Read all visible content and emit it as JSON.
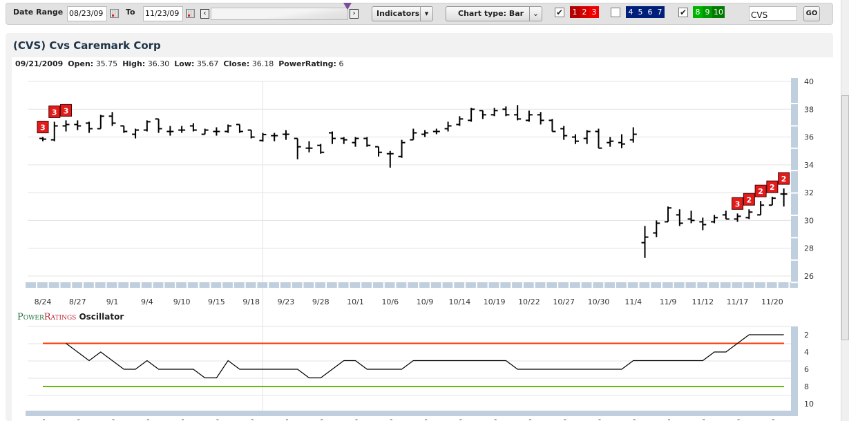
{
  "toolbar": {
    "date_range_label": "Date Range",
    "from": "08/23/09",
    "to_label": "To",
    "to": "11/23/09",
    "indicators_label": "Indicators",
    "chart_type_label": "Chart type: Bar",
    "rating_groups": [
      {
        "checked": true,
        "labels": [
          "1",
          "2",
          "3"
        ],
        "colors": [
          "#b30000",
          "#d40000",
          "#f00000"
        ]
      },
      {
        "checked": false,
        "labels": [
          "4",
          "5",
          "6",
          "7"
        ],
        "colors": [
          "#001f7a",
          "#001f7a",
          "#001f7a",
          "#001f7a"
        ]
      },
      {
        "checked": true,
        "labels": [
          "8",
          "9",
          "10"
        ],
        "colors": [
          "#00b300",
          "#009900",
          "#007a00"
        ]
      }
    ],
    "symbol": "CVS",
    "go_label": "GO"
  },
  "header": {
    "title": "(CVS) Cvs Caremark Corp",
    "date": "09/21/2009",
    "open_label": "Open:",
    "open": "35.75",
    "high_label": "High:",
    "high": "36.30",
    "low_label": "Low:",
    "low": "35.67",
    "close_label": "Close:",
    "close": "36.18",
    "rating_label": "PowerRating:",
    "rating": "6"
  },
  "oscillator": {
    "title_power": "PowerRatings",
    "title_rest": "Oscillator"
  },
  "chart_data": [
    {
      "type": "ohlc-bar",
      "ylim": [
        26,
        40
      ],
      "yticks": [
        26,
        28,
        30,
        32,
        34,
        36,
        38,
        40
      ],
      "grid": true,
      "hover_index": 19,
      "xticks": [
        "8/24",
        "8/27",
        "9/1",
        "9/4",
        "9/10",
        "9/15",
        "9/18",
        "9/23",
        "9/28",
        "10/1",
        "10/6",
        "10/9",
        "10/14",
        "10/19",
        "10/22",
        "10/27",
        "10/30",
        "11/4",
        "11/9",
        "11/12",
        "11/17",
        "11/20"
      ],
      "bars": [
        [
          "8/24",
          35.9,
          36.0,
          35.7,
          35.85
        ],
        [
          "8/25",
          35.8,
          37.1,
          35.7,
          36.8
        ],
        [
          "8/26",
          36.8,
          37.2,
          36.4,
          36.9
        ],
        [
          "8/27",
          36.9,
          37.2,
          36.5,
          36.8
        ],
        [
          "8/28",
          37.0,
          37.1,
          36.3,
          36.6
        ],
        [
          "8/31",
          36.6,
          37.6,
          36.6,
          37.5
        ],
        [
          "9/1",
          37.5,
          37.8,
          36.8,
          37.0
        ],
        [
          "9/2",
          36.8,
          36.8,
          36.3,
          36.4
        ],
        [
          "9/3",
          36.2,
          36.6,
          35.9,
          36.5
        ],
        [
          "9/4",
          36.5,
          37.2,
          36.4,
          37.1
        ],
        [
          "9/8",
          37.3,
          37.3,
          36.3,
          36.6
        ],
        [
          "9/9",
          36.4,
          36.8,
          36.1,
          36.4
        ],
        [
          "9/10",
          36.5,
          36.8,
          36.3,
          36.5
        ],
        [
          "9/11",
          36.8,
          37.0,
          36.4,
          36.5
        ],
        [
          "9/14",
          36.2,
          36.6,
          36.2,
          36.5
        ],
        [
          "9/15",
          36.4,
          36.7,
          36.1,
          36.4
        ],
        [
          "9/16",
          36.4,
          36.9,
          36.3,
          36.8
        ],
        [
          "9/17",
          36.9,
          36.9,
          36.3,
          36.4
        ],
        [
          "9/18",
          36.5,
          36.5,
          35.9,
          36.0
        ],
        [
          "9/21",
          35.75,
          36.3,
          35.67,
          36.18
        ],
        [
          "9/22",
          36.1,
          36.3,
          35.7,
          36.1
        ],
        [
          "9/23",
          36.2,
          36.5,
          35.8,
          36.2
        ],
        [
          "9/24",
          35.9,
          35.9,
          34.4,
          35.3
        ],
        [
          "9/25",
          35.2,
          35.7,
          34.9,
          35.2
        ],
        [
          "9/28",
          35.4,
          35.5,
          34.8,
          34.9
        ],
        [
          "9/29",
          36.3,
          36.4,
          35.5,
          35.9
        ],
        [
          "9/30",
          35.9,
          36.0,
          35.5,
          35.8
        ],
        [
          "10/1",
          35.6,
          36.0,
          35.3,
          35.9
        ],
        [
          "10/2",
          35.9,
          36.0,
          35.3,
          35.4
        ],
        [
          "10/5",
          35.3,
          35.3,
          34.6,
          34.9
        ],
        [
          "10/6",
          34.8,
          35.0,
          33.8,
          34.8
        ],
        [
          "10/7",
          34.6,
          35.8,
          34.5,
          35.6
        ],
        [
          "10/8",
          35.8,
          36.6,
          35.8,
          36.3
        ],
        [
          "10/9",
          36.2,
          36.5,
          36.0,
          36.3
        ],
        [
          "10/12",
          36.4,
          36.6,
          36.2,
          36.4
        ],
        [
          "10/13",
          36.6,
          37.1,
          36.4,
          36.8
        ],
        [
          "10/14",
          36.9,
          37.5,
          36.8,
          37.3
        ],
        [
          "10/15",
          37.2,
          38.1,
          37.1,
          38.0
        ],
        [
          "10/16",
          37.9,
          37.9,
          37.3,
          37.6
        ],
        [
          "10/19",
          37.6,
          38.1,
          37.5,
          37.9
        ],
        [
          "10/20",
          38.0,
          38.2,
          37.5,
          37.6
        ],
        [
          "10/21",
          37.6,
          38.3,
          37.2,
          37.3
        ],
        [
          "10/22",
          37.2,
          37.9,
          37.1,
          37.6
        ],
        [
          "10/23",
          37.6,
          37.8,
          36.9,
          37.2
        ],
        [
          "10/26",
          37.2,
          37.3,
          36.4,
          36.4
        ],
        [
          "10/27",
          36.6,
          36.8,
          35.8,
          36.1
        ],
        [
          "10/28",
          36.0,
          36.2,
          35.5,
          35.7
        ],
        [
          "10/29",
          35.9,
          36.5,
          35.5,
          36.4
        ],
        [
          "10/30",
          36.4,
          36.6,
          35.2,
          35.2
        ],
        [
          "11/2",
          35.6,
          36.0,
          35.3,
          35.7
        ],
        [
          "11/3",
          35.6,
          36.2,
          35.2,
          35.5
        ],
        [
          "11/4",
          35.8,
          36.7,
          35.6,
          36.2
        ],
        [
          "11/5",
          28.4,
          29.6,
          27.3,
          28.8
        ],
        [
          "11/6",
          29.1,
          30.0,
          28.8,
          29.8
        ],
        [
          "11/9",
          29.9,
          31.0,
          29.9,
          30.9
        ],
        [
          "11/10",
          30.4,
          30.8,
          29.6,
          29.8
        ],
        [
          "11/11",
          30.1,
          30.7,
          29.8,
          30.0
        ],
        [
          "11/12",
          29.9,
          30.2,
          29.3,
          29.7
        ],
        [
          "11/13",
          29.9,
          30.4,
          29.8,
          30.2
        ],
        [
          "11/16",
          30.4,
          30.7,
          30.1,
          30.1
        ],
        [
          "11/17",
          30.1,
          30.5,
          29.9,
          30.3
        ],
        [
          "11/18",
          30.2,
          30.8,
          30.1,
          30.6
        ],
        [
          "11/19",
          30.4,
          31.4,
          30.4,
          31.1
        ],
        [
          "11/20",
          31.1,
          31.7,
          31.1,
          31.6
        ],
        [
          "11/23",
          31.9,
          32.3,
          31.0,
          31.9
        ]
      ],
      "rating_badges": [
        [
          0,
          "3"
        ],
        [
          1,
          "3"
        ],
        [
          2,
          "3"
        ],
        [
          60,
          "3"
        ],
        [
          61,
          "2"
        ],
        [
          62,
          "2"
        ],
        [
          63,
          "2"
        ],
        [
          64,
          "2"
        ]
      ],
      "colors": {
        "bar": "#000000",
        "badge": "#e31b1b"
      }
    },
    {
      "type": "line",
      "ylim": [
        10,
        2
      ],
      "yticks": [
        2,
        4,
        6,
        8,
        10
      ],
      "grid": true,
      "upper_line": 3,
      "lower_line": 8,
      "colors": {
        "line": "#000000",
        "upper": "#ff3300",
        "lower": "#66bb00"
      },
      "start_index": 2,
      "values": [
        3,
        4,
        5,
        4,
        5,
        6,
        6,
        5,
        6,
        6,
        6,
        6,
        7,
        7,
        5,
        6,
        6,
        6,
        6,
        6,
        6,
        7,
        7,
        6,
        5,
        5,
        6,
        6,
        6,
        6,
        5,
        5,
        5,
        5,
        5,
        5,
        5,
        5,
        5,
        6,
        6,
        6,
        6,
        6,
        6,
        6,
        6,
        6,
        6,
        5,
        5,
        5,
        5,
        5,
        5,
        5,
        4,
        4,
        3,
        2,
        2,
        2,
        2
      ]
    }
  ]
}
